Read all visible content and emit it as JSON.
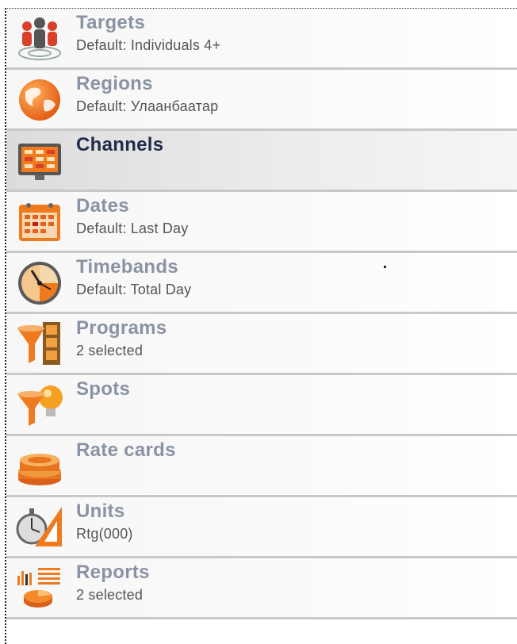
{
  "menu": {
    "items": [
      {
        "id": "targets",
        "label": "Targets",
        "subtitle": "Default: Individuals 4+",
        "icon": "people-target-icon",
        "active": false
      },
      {
        "id": "regions",
        "label": "Regions",
        "subtitle": "Default: Улаанбаатар",
        "icon": "globe-icon",
        "active": false
      },
      {
        "id": "channels",
        "label": "Channels",
        "subtitle": "",
        "icon": "tv-channels-icon",
        "active": true
      },
      {
        "id": "dates",
        "label": "Dates",
        "subtitle": "Default: Last Day",
        "icon": "calendar-icon",
        "active": false
      },
      {
        "id": "timebands",
        "label": "Timebands",
        "subtitle": "Default: Total Day",
        "icon": "clock-icon",
        "active": false
      },
      {
        "id": "programs",
        "label": "Programs",
        "subtitle": "2 selected",
        "icon": "funnel-film-icon",
        "active": false
      },
      {
        "id": "spots",
        "label": "Spots",
        "subtitle": "",
        "icon": "funnel-bulb-icon",
        "active": false
      },
      {
        "id": "rate_cards",
        "label": "Rate cards",
        "subtitle": "",
        "icon": "coin-stack-icon",
        "active": false
      },
      {
        "id": "units",
        "label": "Units",
        "subtitle": "Rtg(000)",
        "icon": "stopwatch-ruler-icon",
        "active": false
      },
      {
        "id": "reports",
        "label": "Reports",
        "subtitle": "2 selected",
        "icon": "chart-report-icon",
        "active": false
      }
    ]
  },
  "colors": {
    "accent": "#f07a1e",
    "title_inactive": "#8a93a3",
    "title_active": "#1e2c48",
    "separator": "#c8c8c8"
  }
}
